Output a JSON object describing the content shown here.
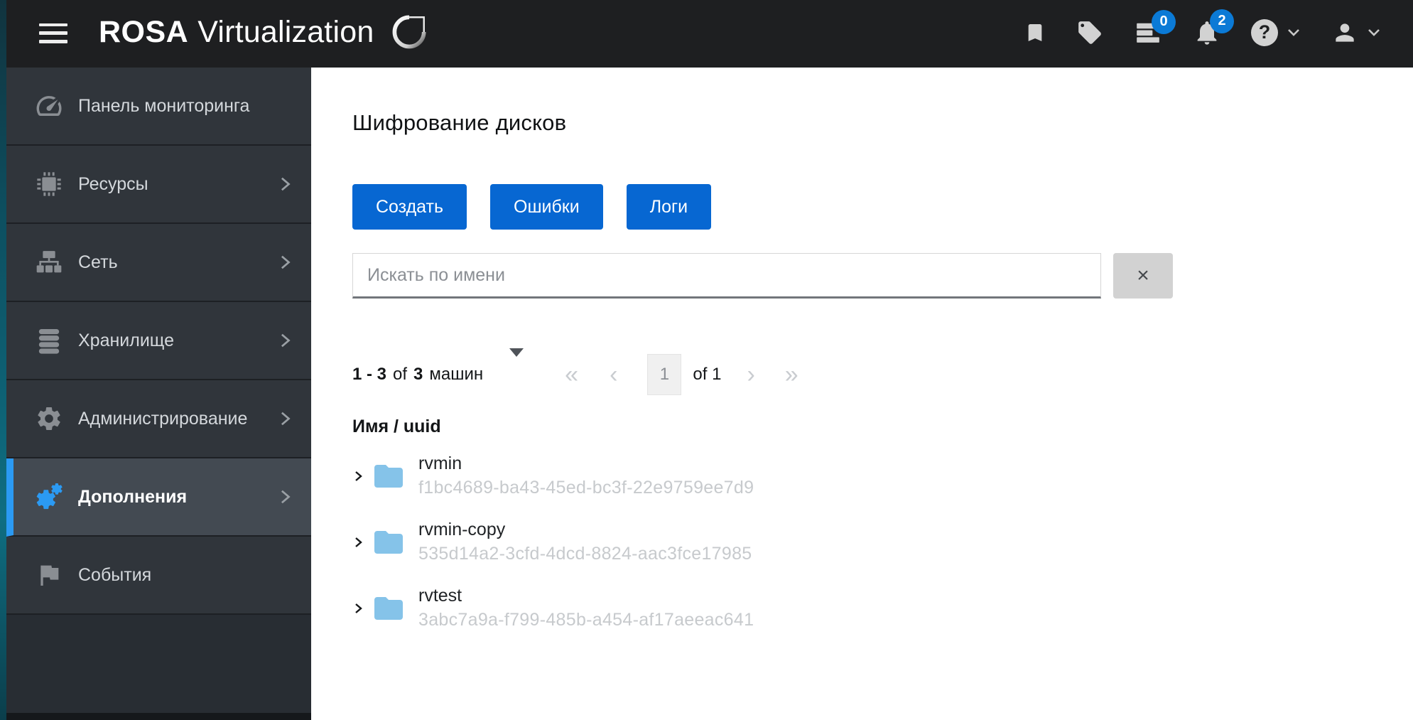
{
  "header": {
    "brand_name": "ROSA",
    "brand_product": "Virtualization",
    "tasks_badge": "0",
    "notifications_badge": "2"
  },
  "icons": {
    "help": "?",
    "clear": "×",
    "page_first": "«",
    "page_prev": "‹",
    "page_next": "›",
    "page_last": "»"
  },
  "sidebar": {
    "items": [
      {
        "label": "Панель мониторинга",
        "icon": "dashboard-icon",
        "has_submenu": false,
        "active": false
      },
      {
        "label": "Ресурсы",
        "icon": "chip-icon",
        "has_submenu": true,
        "active": false
      },
      {
        "label": "Сеть",
        "icon": "network-icon",
        "has_submenu": true,
        "active": false
      },
      {
        "label": "Хранилище",
        "icon": "database-icon",
        "has_submenu": true,
        "active": false
      },
      {
        "label": "Администрирование",
        "icon": "gear-icon",
        "has_submenu": true,
        "active": false
      },
      {
        "label": "Дополнения",
        "icon": "gears-icon",
        "has_submenu": true,
        "active": true
      },
      {
        "label": "События",
        "icon": "flag-icon",
        "has_submenu": false,
        "active": false
      }
    ]
  },
  "main": {
    "title": "Шифрование дисков",
    "action_buttons": [
      {
        "label": "Создать"
      },
      {
        "label": "Ошибки"
      },
      {
        "label": "Логи"
      }
    ],
    "search": {
      "placeholder": "Искать по имени",
      "value": ""
    },
    "pagination": {
      "range": "1 - 3",
      "of_word": "of",
      "total": "3",
      "unit": "машин",
      "page": "1",
      "pages_label": "of 1"
    },
    "table": {
      "header": "Имя / uuid",
      "rows": [
        {
          "name": "rvmin",
          "uuid": "f1bc4689-ba43-45ed-bc3f-22e9759ee7d9"
        },
        {
          "name": "rvmin-copy",
          "uuid": "535d14a2-3cfd-4dcd-8824-aac3fce17985"
        },
        {
          "name": "rvtest",
          "uuid": "3abc7a9a-f799-485b-a454-af17aeeac641"
        }
      ]
    }
  },
  "colors": {
    "primary_blue": "#0767d2",
    "active_nav_blue": "#2b9af3",
    "badge_blue": "#0b7ad6",
    "folder_blue": "#85c3e9",
    "masthead_bg": "#1e1f21",
    "sidebar_item_bg": "#30353b",
    "sidebar_active_bg": "#434a52"
  }
}
